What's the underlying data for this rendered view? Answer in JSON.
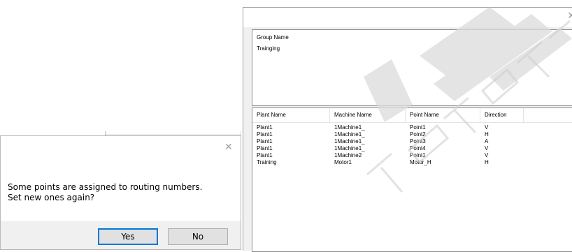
{
  "group_panel": {
    "label": "Group Name",
    "value": "Trainging"
  },
  "points_table": {
    "columns": [
      "Plant Name",
      "Machine Name",
      "Point Name",
      "Direction"
    ],
    "rows": [
      [
        "Plant1",
        "1Machine1_",
        "Point1",
        "V"
      ],
      [
        "Plant1",
        "1Machine1_",
        "Point2",
        "H"
      ],
      [
        "Plant1",
        "1Machine1_",
        "Point3",
        "A"
      ],
      [
        "Plant1",
        "1Machine1_",
        "Point4",
        "V"
      ],
      [
        "Plant1",
        "1Machine2",
        "Point1",
        "V"
      ],
      [
        "Training",
        "Motor1",
        "Motor_H",
        "H"
      ]
    ]
  },
  "dialog": {
    "message_line1": "Some points are assigned to routing numbers.",
    "message_line2": "Set new ones again?",
    "yes_label": "Yes",
    "no_label": "No",
    "close_glyph": "✕"
  },
  "window_close_glyph": "✕",
  "colors": {
    "accent": "#0078d7",
    "footer_bg": "#f0f0f0",
    "button_bg": "#e1e1e1"
  }
}
